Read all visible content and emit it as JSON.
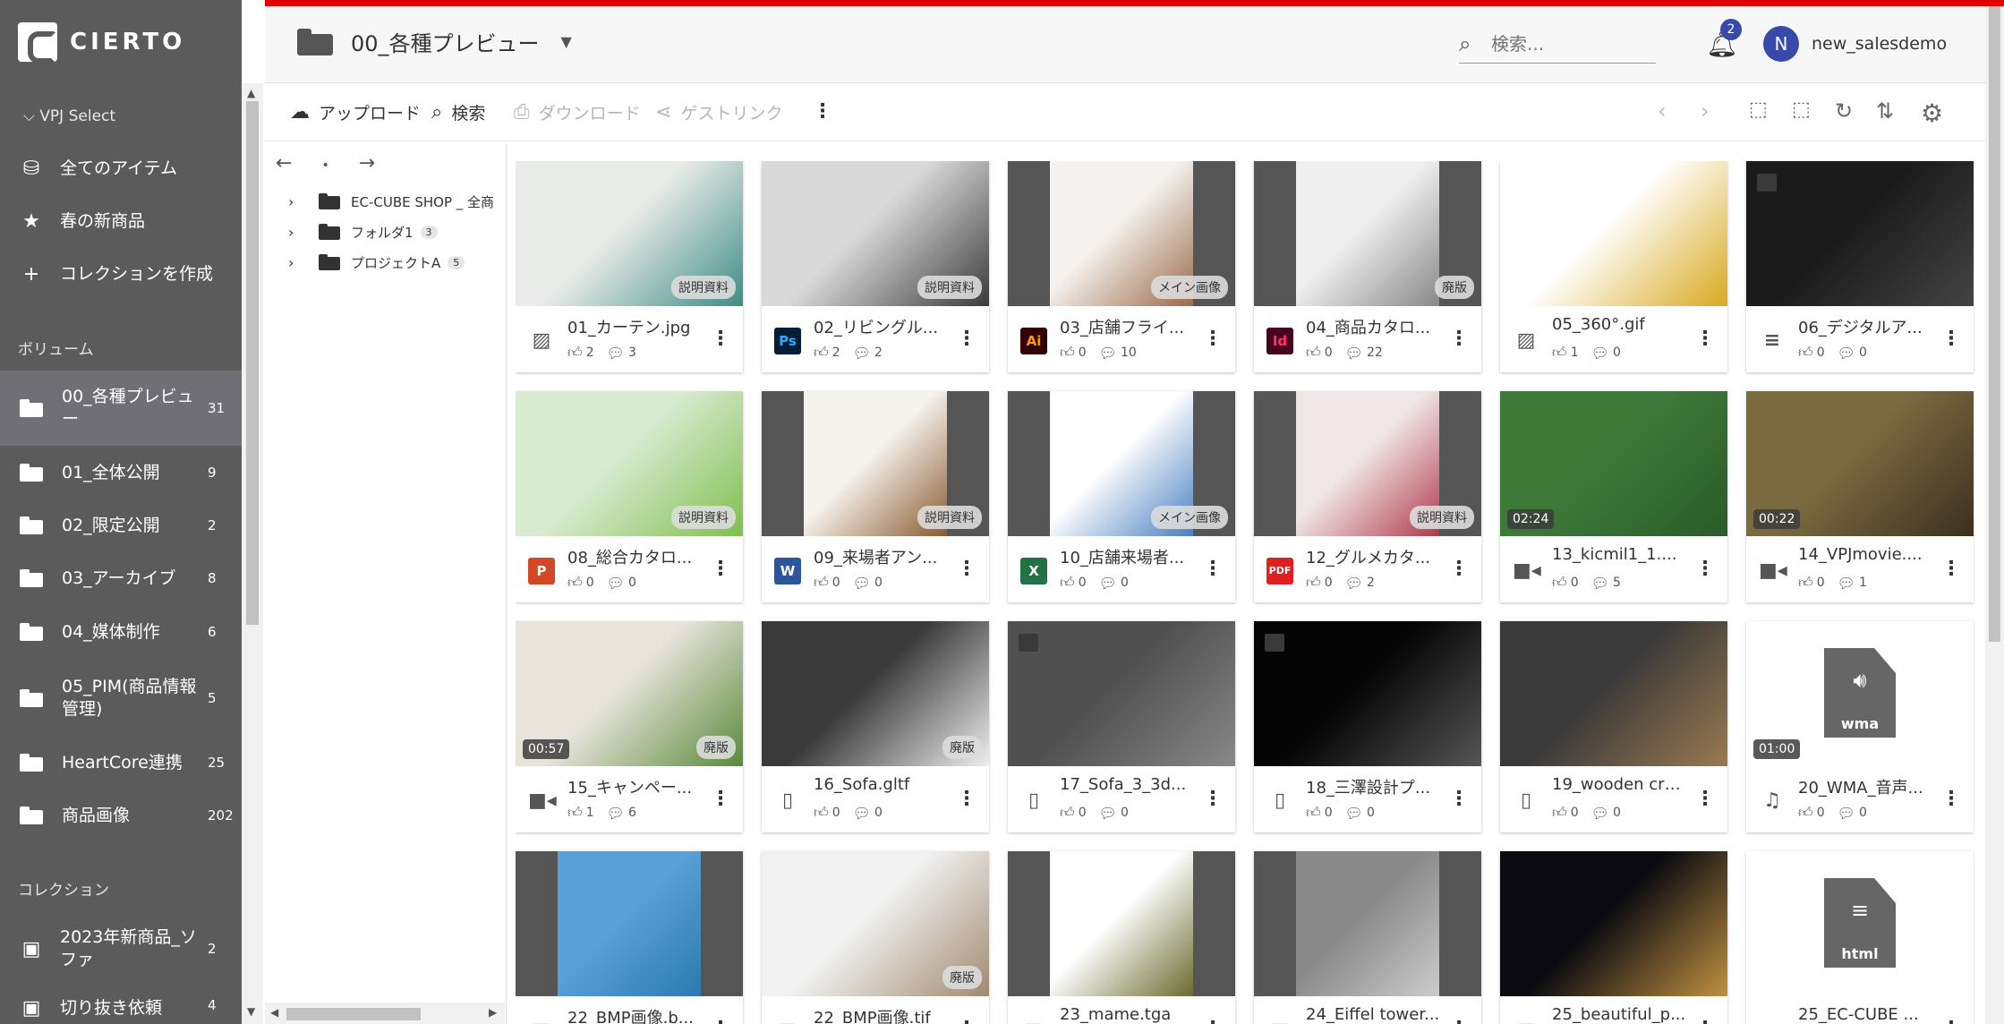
{
  "app": {
    "logo_text": "CIERTO",
    "workspace": "VPJ Select"
  },
  "sidebar": {
    "nav": [
      {
        "label": "全てのアイテム",
        "icon": "database-icon"
      },
      {
        "label": "春の新商品",
        "icon": "star-icon"
      },
      {
        "label": "コレクションを作成",
        "icon": "plus-icon"
      }
    ],
    "volume_heading": "ボリューム",
    "volumes": [
      {
        "label": "00_各種プレビュー",
        "count": "31",
        "active": true
      },
      {
        "label": "01_全体公開",
        "count": "9"
      },
      {
        "label": "02_限定公開",
        "count": "2"
      },
      {
        "label": "03_アーカイブ",
        "count": "8"
      },
      {
        "label": "04_媒体制作",
        "count": "6"
      },
      {
        "label": "05_PIM(商品情報管理)",
        "count": "5"
      },
      {
        "label": "HeartCore連携",
        "count": "25"
      },
      {
        "label": "商品画像",
        "count": "202"
      }
    ],
    "collection_heading": "コレクション",
    "collections": [
      {
        "label": "2023年新商品_ソファ",
        "count": "2"
      },
      {
        "label": "切り抜き依頼",
        "count": "4"
      }
    ]
  },
  "header": {
    "folder_title": "00_各種プレビュー",
    "search_placeholder": "検索...",
    "notification_count": "2",
    "user_initial": "N",
    "user_name": "new_salesdemo"
  },
  "toolbar": {
    "upload": "アップロード",
    "search": "検索",
    "download": "ダウンロード",
    "guestlink": "ゲストリンク"
  },
  "tree": {
    "nodes": [
      {
        "label": "EC-CUBE SHOP _ 全商",
        "count": ""
      },
      {
        "label": "フォルダ1",
        "count": "3"
      },
      {
        "label": "プロジェクトA",
        "count": "5"
      }
    ]
  },
  "assets": [
    {
      "name": "01_カーテン.jpg",
      "badge": "説明資料",
      "type": "image",
      "likes": "2",
      "comments": "3",
      "bg": "#e9ece8",
      "accent": "#3f8c86"
    },
    {
      "name": "02_リビングル...",
      "badge": "説明資料",
      "type": "ps",
      "likes": "2",
      "comments": "2",
      "bg": "#d9d9d9",
      "accent": "#3b3b3b"
    },
    {
      "name": "03_店舗フライ...",
      "badge": "メイン画像",
      "type": "ai",
      "likes": "0",
      "comments": "10",
      "bg": "#f4f1ee",
      "accent": "#9a6a4a"
    },
    {
      "name": "04_商品カタロ...",
      "badge": "廃版",
      "type": "id",
      "likes": "0",
      "comments": "22",
      "bg": "#efefef",
      "accent": "#888888"
    },
    {
      "name": "05_360°.gif",
      "badge": "",
      "type": "image",
      "likes": "1",
      "comments": "0",
      "bg": "#ffffff",
      "accent": "#d9a920"
    },
    {
      "name": "06_デジタルア...",
      "badge": "",
      "type": "doc",
      "likes": "0",
      "comments": "0",
      "bg": "#1b1b1b",
      "accent": "#444444"
    },
    {
      "name": "08_総合カタロ...",
      "badge": "説明資料",
      "type": "ppt",
      "likes": "0",
      "comments": "0",
      "bg": "#d8ead0",
      "accent": "#7fbf4f"
    },
    {
      "name": "09_来場者アン...",
      "badge": "説明資料",
      "type": "word",
      "likes": "0",
      "comments": "0",
      "bg": "#f6f3ee",
      "accent": "#8a5a30"
    },
    {
      "name": "10_店舗来場者...",
      "badge": "メイン画像",
      "type": "excel",
      "likes": "0",
      "comments": "0",
      "bg": "#ffffff",
      "accent": "#4a7ec0"
    },
    {
      "name": "12_グルメカタ...",
      "badge": "説明資料",
      "type": "pdf",
      "likes": "0",
      "comments": "2",
      "bg": "#f0e6e6",
      "accent": "#b03a4a"
    },
    {
      "name": "13_kicmil1_1....",
      "badge": "",
      "duration": "02:24",
      "type": "video",
      "likes": "0",
      "comments": "5",
      "bg": "#3d7a3a",
      "accent": "#2a5a28"
    },
    {
      "name": "14_VPJmovie....",
      "badge": "",
      "duration": "00:22",
      "type": "video",
      "likes": "0",
      "comments": "1",
      "bg": "#7a6a40",
      "accent": "#3a3020"
    },
    {
      "name": "15_キャンペー...",
      "badge": "廃版",
      "duration": "00:57",
      "type": "video",
      "likes": "1",
      "comments": "6",
      "bg": "#e8e4dc",
      "accent": "#5a8a3a"
    },
    {
      "name": "16_Sofa.gltf",
      "badge": "廃版",
      "type": "file",
      "likes": "0",
      "comments": "0",
      "bg": "#3a3a3a",
      "accent": "#eeeeee"
    },
    {
      "name": "17_Sofa_3_3d...",
      "badge": "",
      "type": "file",
      "likes": "0",
      "comments": "0",
      "bg": "#505050",
      "accent": "#888888"
    },
    {
      "name": "18_三澤設計プ...",
      "badge": "",
      "type": "file",
      "likes": "0",
      "comments": "0",
      "bg": "#050505",
      "accent": "#555555"
    },
    {
      "name": "19_wooden cra...",
      "badge": "",
      "type": "file",
      "likes": "0",
      "comments": "0",
      "bg": "#3a3a3a",
      "accent": "#9a7a50"
    },
    {
      "name": "20_WMA_音声...",
      "badge": "",
      "duration": "01:00",
      "type": "audio",
      "likes": "0",
      "comments": "0",
      "bg": "#ffffff",
      "accent": "#5a5a5a",
      "filelabel": "wma"
    },
    {
      "name": "22_BMP画像.b...",
      "badge": "",
      "type": "image",
      "likes": "",
      "comments": "",
      "bg": "#5aa0d8",
      "accent": "#2a7ab0"
    },
    {
      "name": "22_BMP画像.tif",
      "badge": "廃版",
      "type": "image",
      "likes": "",
      "comments": "",
      "bg": "#f2f2f2",
      "accent": "#a08a70"
    },
    {
      "name": "23_mame.tga",
      "badge": "",
      "type": "image",
      "likes": "",
      "comments": "",
      "bg": "#ffffff",
      "accent": "#6a6a30"
    },
    {
      "name": "24_Eiffel tower...",
      "badge": "",
      "type": "image",
      "likes": "",
      "comments": "",
      "bg": "#8a8a8a",
      "accent": "#cccccc"
    },
    {
      "name": "25_beautiful_p...",
      "badge": "",
      "type": "image",
      "likes": "",
      "comments": "",
      "bg": "#0a0a10",
      "accent": "#c09040"
    },
    {
      "name": "25_EC-CUBE ...",
      "badge": "",
      "type": "doc",
      "likes": "",
      "comments": "",
      "bg": "#ffffff",
      "accent": "#5a5a5a",
      "filelabel": "html"
    }
  ]
}
